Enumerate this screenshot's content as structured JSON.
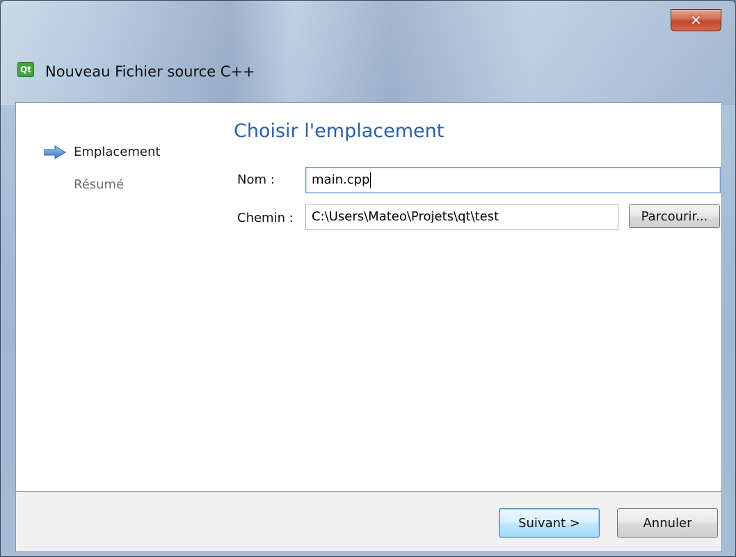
{
  "window": {
    "title": "Nouveau Fichier source C++",
    "app_icon_text": "Qt",
    "close_glyph": "✕"
  },
  "sidebar": {
    "steps": [
      {
        "label": "Emplacement",
        "active": true
      },
      {
        "label": "Résumé",
        "active": false
      }
    ]
  },
  "main": {
    "title": "Choisir l'emplacement",
    "name_label": "Nom :",
    "name_value": "main.cpp",
    "path_label": "Chemin :",
    "path_value": "C:\\Users\\Mateo\\Projets\\qt\\test",
    "browse_label": "Parcourir..."
  },
  "footer": {
    "next_label": "Suivant >",
    "cancel_label": "Annuler"
  },
  "colors": {
    "title_blue": "#2a5ea8",
    "arrow_blue": "#4f86d6",
    "close_red": "#c2452a"
  },
  "icons": {
    "step_arrow": "arrow-right-icon",
    "app": "qt-creator-icon",
    "close": "close-icon"
  }
}
